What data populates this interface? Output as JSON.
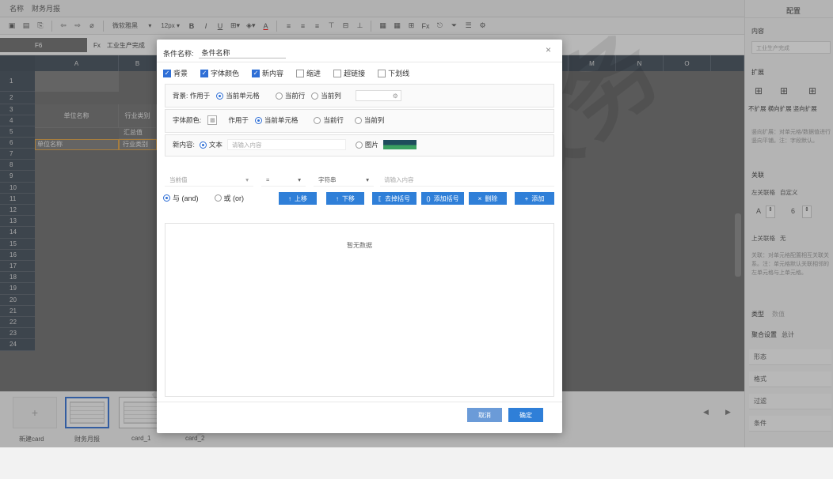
{
  "app": {
    "name_label": "名称",
    "report_name": "财务月报"
  },
  "toolbar": {
    "font": "微软雅黑",
    "size": "12px",
    "bold": "B",
    "italic": "I",
    "underline": "U",
    "color_a": "A",
    "fx": "Fx"
  },
  "formula": {
    "cell": "F6",
    "fx": "Fx",
    "content": "工业生产完成"
  },
  "grid": {
    "columns": [
      "A",
      "B",
      "",
      "",
      "",
      "",
      "",
      "",
      "",
      "",
      "",
      "",
      "M",
      "N",
      "O"
    ],
    "rows": [
      "1",
      "2",
      "3",
      "4",
      "5",
      "6",
      "7",
      "8",
      "9",
      "10",
      "11",
      "12",
      "13",
      "14",
      "15",
      "16",
      "17",
      "18",
      "19",
      "20",
      "21",
      "22",
      "23",
      "24"
    ],
    "cells": {
      "a3": "单位名称",
      "b3": "行业类别",
      "b5": "汇总值",
      "a6": "单位名称",
      "b6": "行业类别"
    }
  },
  "cards": [
    {
      "label": "新建card"
    },
    {
      "label": "财务月报"
    },
    {
      "label": "card_1"
    },
    {
      "label": "card_2"
    }
  ],
  "add_symbol": "+",
  "right": {
    "title": "配置",
    "content_label": "内容",
    "content_value": "工业生产完成",
    "expand_label": "扩展",
    "expand_opts": [
      "不扩展",
      "横向扩展",
      "竖向扩展"
    ],
    "expand_desc": "竖向扩展：对单元格/数据值进行竖向平铺。注：字段默认。",
    "link_label": "关联",
    "left_link": "左关联格",
    "left_link_value": "自定义",
    "col_letter": "A",
    "row_num": "6",
    "top_link": "上关联格",
    "top_link_value": "无",
    "link_desc": "关联：对单元格配置相互关联关系。注：单元格默认关联相邻的左单元格与上单元格。",
    "type_label": "类型",
    "type_value": "数值",
    "agg_label": "聚合设置",
    "agg_value": "总计",
    "rows": [
      "形态",
      "格式",
      "过滤",
      "条件"
    ]
  },
  "dialog": {
    "title_label": "条件名称:",
    "title_value": "条件名称",
    "close": "×",
    "checks": [
      {
        "label": "背景",
        "on": true
      },
      {
        "label": "字体颜色",
        "on": true
      },
      {
        "label": "新内容",
        "on": true
      },
      {
        "label": "缩进",
        "on": false
      },
      {
        "label": "超链接",
        "on": false
      },
      {
        "label": "下划线",
        "on": false
      }
    ],
    "bg_label": "背景: 作用于",
    "apply_opts": [
      "当前单元格",
      "当前行",
      "当前列"
    ],
    "font_label": "字体颜色:",
    "apply_label": "作用于",
    "content_label": "新内容:",
    "text_opt": "文本",
    "content_placeholder": "请输入内容",
    "image_opt": "图片",
    "filter": {
      "field": "当前值",
      "op": "=",
      "type": "字符串",
      "value_placeholder": "请输入内容"
    },
    "logic": [
      "与 (and)",
      "或 (or)"
    ],
    "buttons": [
      "上移",
      "下移",
      "去掉括号",
      "添加括号",
      "删除",
      "添加"
    ],
    "empty": "暂无数据",
    "cancel": "取消",
    "confirm": "确定"
  },
  "watermark": "专业软件服务"
}
